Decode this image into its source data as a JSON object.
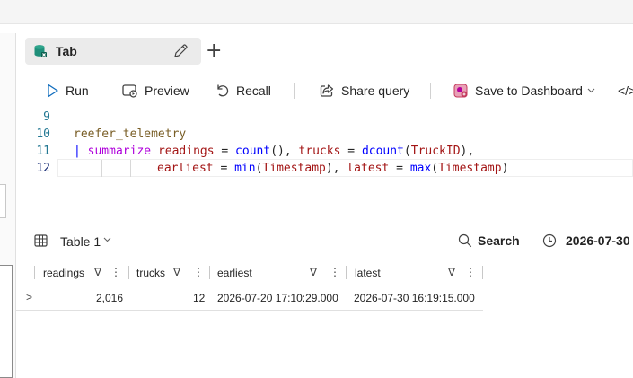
{
  "tab": {
    "label": "Tab",
    "add_label": "+"
  },
  "toolbar": {
    "run": "Run",
    "preview": "Preview",
    "recall": "Recall",
    "share": "Share query",
    "save_dashboard": "Save to Dashboard",
    "more": "</>"
  },
  "editor": {
    "line_numbers": [
      "9",
      "10",
      "11",
      "12"
    ],
    "lines": [
      {
        "t1": ""
      },
      {
        "table": "reefer_telemetry"
      },
      {
        "pipe": "| ",
        "kw": "summarize",
        "rest_a": " ",
        "var1": "readings",
        "eq1": " = ",
        "fn1": "count",
        "p1": "(), ",
        "var2": "trucks",
        "eq2": " = ",
        "fn2": "dcount",
        "p2a": "(",
        "fld1": "TruckID",
        "p2b": "),"
      },
      {
        "var3": "earliest",
        "eq3": " = ",
        "fn3": "min",
        "p3a": "(",
        "fld2": "Timestamp",
        "p3b": "), ",
        "var4": "latest",
        "eq4": " = ",
        "fn4": "max",
        "p4a": "(",
        "fld3": "Timestamp",
        "p4b": ")"
      }
    ]
  },
  "results": {
    "title": "Table 1",
    "search": "Search",
    "time_value": "2026-07-30",
    "columns": [
      "readings",
      "trucks",
      "earliest",
      "latest"
    ],
    "rows": [
      {
        "expander": ">",
        "readings": "2,016",
        "trucks": "12",
        "earliest": "2026-07-20 17:10:29.000",
        "latest": "2026-07-30 16:19:15.000"
      }
    ]
  },
  "colors": {
    "accent": "#0f6cbd",
    "keyword": "#af00db",
    "function": "#0000ff",
    "identifier": "#a31515"
  }
}
